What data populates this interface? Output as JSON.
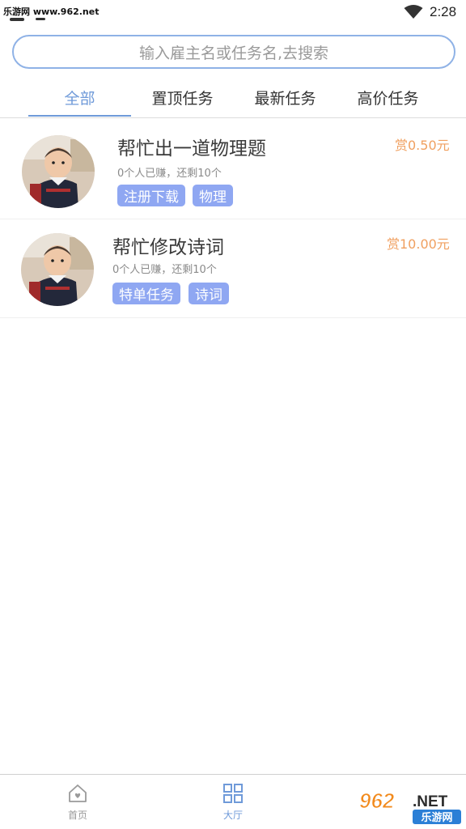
{
  "status_bar": {
    "watermark": "乐游网 www.962.net",
    "time": "2:28",
    "icons": [
      "notification-icon",
      "wifi-icon"
    ]
  },
  "search": {
    "placeholder": "输入雇主名或任务名,去搜索"
  },
  "tabs": [
    {
      "label": "全部",
      "active": true
    },
    {
      "label": "置顶任务",
      "active": false
    },
    {
      "label": "最新任务",
      "active": false
    },
    {
      "label": "高价任务",
      "active": false
    }
  ],
  "tasks": [
    {
      "title": "帮忙出一道物理题",
      "reward": "赏0.50元",
      "progress": "0个人已赚，还剩10个",
      "tags": [
        "注册下载",
        "物理"
      ]
    },
    {
      "title": "帮忙修改诗词",
      "reward": "赏10.00元",
      "progress": "0个人已赚，还剩10个",
      "tags": [
        "特单任务",
        "诗词"
      ]
    }
  ],
  "bottom_nav": [
    {
      "label": "首页",
      "icon": "home-icon",
      "active": false
    },
    {
      "label": "大厅",
      "icon": "grid-icon",
      "active": true
    }
  ],
  "watermark_logo": {
    "text": "962.NET",
    "subtext": "乐游网"
  },
  "colors": {
    "accent": "#6f9ad9",
    "reward": "#f0a060",
    "tag_bg": "#8fa7f2",
    "search_border": "#8fb2e6"
  }
}
